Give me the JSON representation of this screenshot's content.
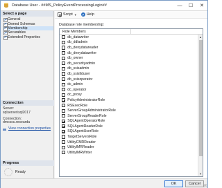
{
  "window": {
    "title": "Database User - ##MS_PolicyEventProcessingLogin##",
    "buttons": [
      "—",
      "☐",
      "✕"
    ]
  },
  "left_panel": {
    "select_page_header": "Select a page",
    "pages": [
      {
        "label": "General",
        "selected": false
      },
      {
        "label": "Owned Schemas",
        "selected": false
      },
      {
        "label": "Membership",
        "selected": true
      },
      {
        "label": "Securables",
        "selected": false
      },
      {
        "label": "Extended Properties",
        "selected": false
      }
    ],
    "connection_header": "Connection",
    "server_label": "Server:",
    "server_value": "sqlserver\\sql2017",
    "connection_label": "Connection:",
    "connection_value": "dmcssu.researda",
    "view_connection_link": "View connection properties",
    "progress_header": "Progress",
    "status": "Ready"
  },
  "toolbar": {
    "script_label": "Script",
    "help_label": "Help"
  },
  "main": {
    "members_label": "Database role membership:",
    "column_header": "Role Members",
    "roles": [
      {
        "name": "db_datawriter",
        "checked": false
      },
      {
        "name": "db_ddladmin",
        "checked": false
      },
      {
        "name": "db_denydatareader",
        "checked": false
      },
      {
        "name": "db_denydatawriter",
        "checked": false
      },
      {
        "name": "db_owner",
        "checked": false
      },
      {
        "name": "db_securityadmin",
        "checked": false
      },
      {
        "name": "db_ssisadmin",
        "checked": false
      },
      {
        "name": "db_ssisltduser",
        "checked": false
      },
      {
        "name": "db_ssisoperator",
        "checked": false
      },
      {
        "name": "dc_admin",
        "checked": false
      },
      {
        "name": "dc_operator",
        "checked": false
      },
      {
        "name": "dc_proxy",
        "checked": false
      },
      {
        "name": "PolicyAdministratorRole",
        "checked": true
      },
      {
        "name": "RSExecRole",
        "checked": false
      },
      {
        "name": "ServerGroupAdministratorRole",
        "checked": false
      },
      {
        "name": "ServerGroupReaderRole",
        "checked": false
      },
      {
        "name": "SQLAgentOperatorRole",
        "checked": true
      },
      {
        "name": "SQLAgentReaderRole",
        "checked": true
      },
      {
        "name": "SQLAgentUserRole",
        "checked": true
      },
      {
        "name": "TargetServersRole",
        "checked": false
      },
      {
        "name": "UtilityCMRReader",
        "checked": false
      },
      {
        "name": "UtilityIMRReader",
        "checked": false
      },
      {
        "name": "UtilityIMRWriter",
        "checked": false
      }
    ]
  },
  "footer": {
    "ok_label": "OK",
    "cancel_label": "Cancel"
  }
}
